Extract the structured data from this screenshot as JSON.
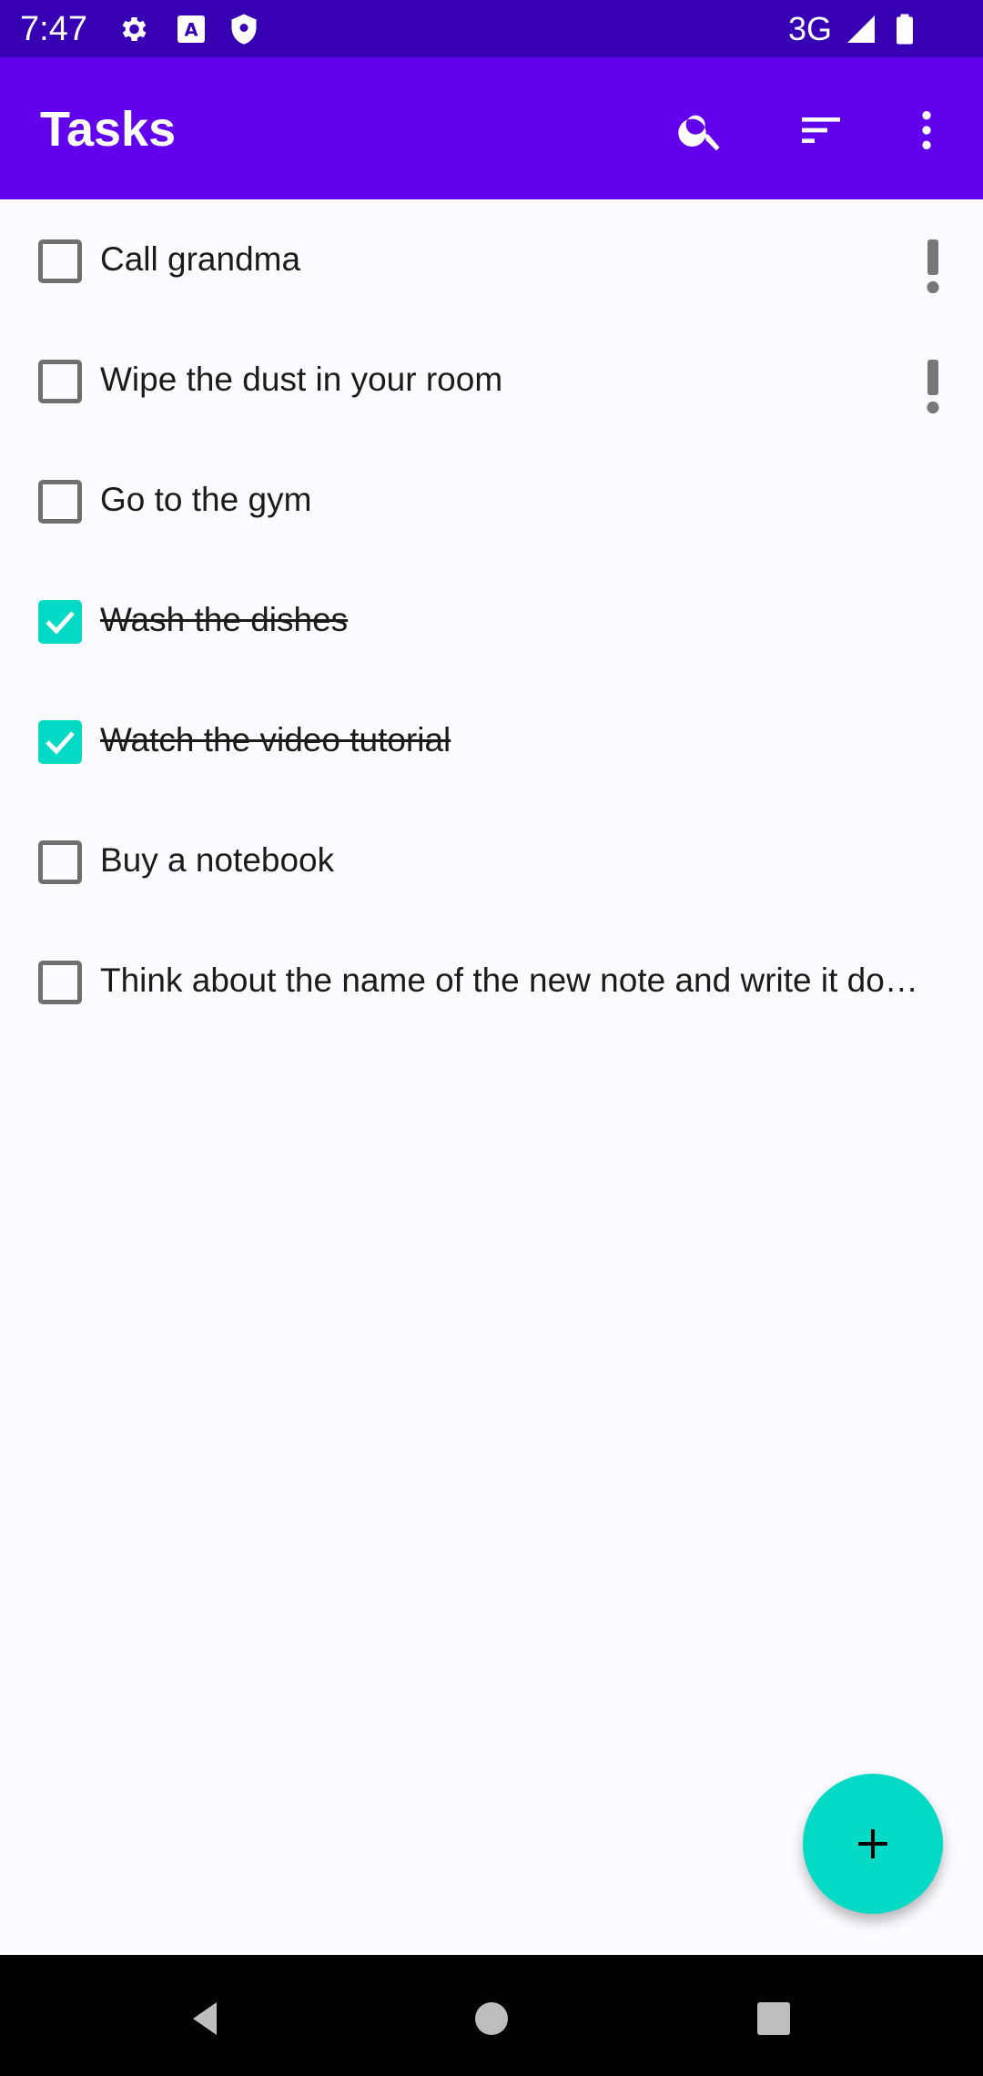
{
  "status_bar": {
    "time": "7:47",
    "network": "3G",
    "icons": [
      "gear-icon",
      "a-box-icon",
      "shield-icon",
      "signal-icon",
      "battery-icon"
    ]
  },
  "app_bar": {
    "title": "Tasks",
    "actions": [
      "search-icon",
      "sort-icon",
      "more-vert-icon"
    ],
    "background": "#6200ee"
  },
  "tasks": [
    {
      "label": "Call grandma",
      "completed": false,
      "important": true
    },
    {
      "label": "Wipe the dust in your room",
      "completed": false,
      "important": true
    },
    {
      "label": "Go to the gym",
      "completed": false,
      "important": false
    },
    {
      "label": "Wash the dishes",
      "completed": true,
      "important": false
    },
    {
      "label": "Watch the video tutorial",
      "completed": true,
      "important": false
    },
    {
      "label": "Buy a notebook",
      "completed": false,
      "important": false
    },
    {
      "label": "Think about the name of the new note and write it do…",
      "completed": false,
      "important": false
    }
  ],
  "fab": {
    "icon": "plus-icon",
    "color": "#03dac5"
  },
  "nav_bar": {
    "buttons": [
      "back-icon",
      "home-icon",
      "recents-icon"
    ]
  },
  "colors": {
    "status_bar": "#3700b3",
    "primary": "#6200ee",
    "accent": "#03dac5",
    "priority_icon": "#777777"
  }
}
